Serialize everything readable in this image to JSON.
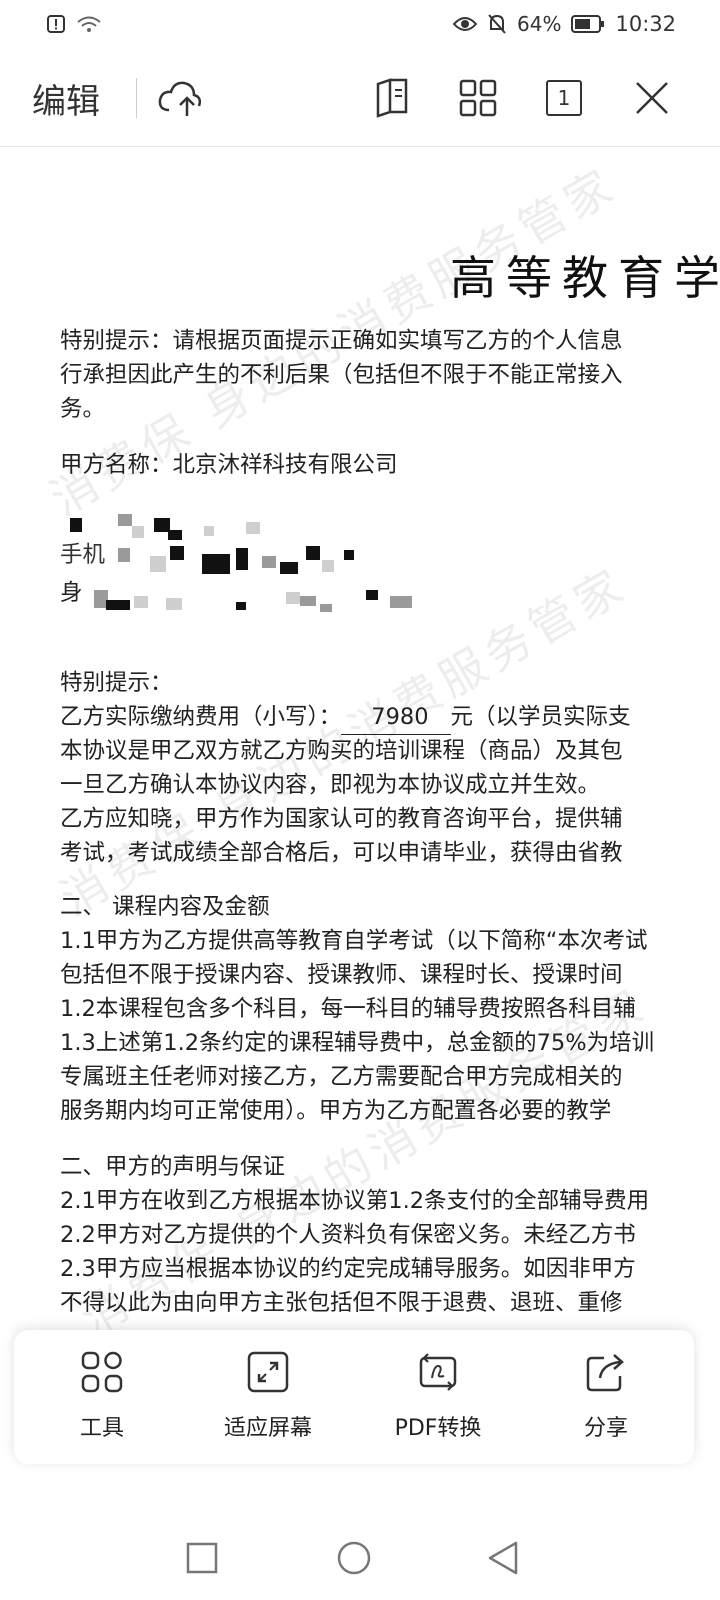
{
  "status_bar": {
    "battery_percent": "64%",
    "time": "10:32"
  },
  "toolbar": {
    "edit_label": "编辑",
    "page_badge": "1"
  },
  "document": {
    "title": "高等教育学历",
    "notice_lines": [
      "特别提示：请根据页面提示正确如实填写乙方的个人信息",
      "行承担因此产生的不利后果（包括但不限于不能正常接入",
      "务。"
    ],
    "party_a": "甲方名称：北京沐祥科技有限公司",
    "partial_phone_label": "手机",
    "partial_id_label": "身",
    "special_notice": "特别提示：",
    "fee_prefix": "乙方实际缴纳费用（小写）：",
    "fee_amount": "7980",
    "fee_suffix": "元（以学员实际支",
    "body_lines": [
      "本协议是甲乙双方就乙方购买的培训课程（商品）及其包",
      "一旦乙方确认本协议内容，即视为本协议成立并生效。",
      "乙方应知晓，甲方作为国家认可的教育咨询平台，提供辅",
      "考试，考试成绩全部合格后，可以申请毕业，获得由省教",
      "",
      "二、 课程内容及金额",
      "1.1甲方为乙方提供高等教育自学考试（以下简称“本次考试",
      "包括但不限于授课内容、授课教师、课程时长、授课时间",
      "1.2本课程包含多个科目，每一科目的辅导费按照各科目辅",
      "1.3上述第1.2条约定的课程辅导费中，总金额的75%为培训",
      "专属班主任老师对接乙方，乙方需要配合甲方完成相关的",
      "服务期内均可正常使用）。甲方为乙方配置各必要的教学",
      "",
      "二、甲方的声明与保证",
      "2.1甲方在收到乙方根据本协议第1.2条支付的全部辅导费用",
      "2.2甲方对乙方提供的个人资料负有保密义务。未经乙方书",
      "2.3甲方应当根据本协议的约定完成辅导服务。如因非甲方",
      "不得以此为由向甲方主张包括但不限于退费、退班、重修"
    ],
    "watermark": "消费保 身边的消费服务管家"
  },
  "bottom_toolbar": {
    "items": [
      {
        "label": "工具",
        "icon": "tools-grid-icon"
      },
      {
        "label": "适应屏幕",
        "icon": "fit-screen-icon"
      },
      {
        "label": "PDF转换",
        "icon": "pdf-convert-icon"
      },
      {
        "label": "分享",
        "icon": "share-icon"
      }
    ]
  }
}
